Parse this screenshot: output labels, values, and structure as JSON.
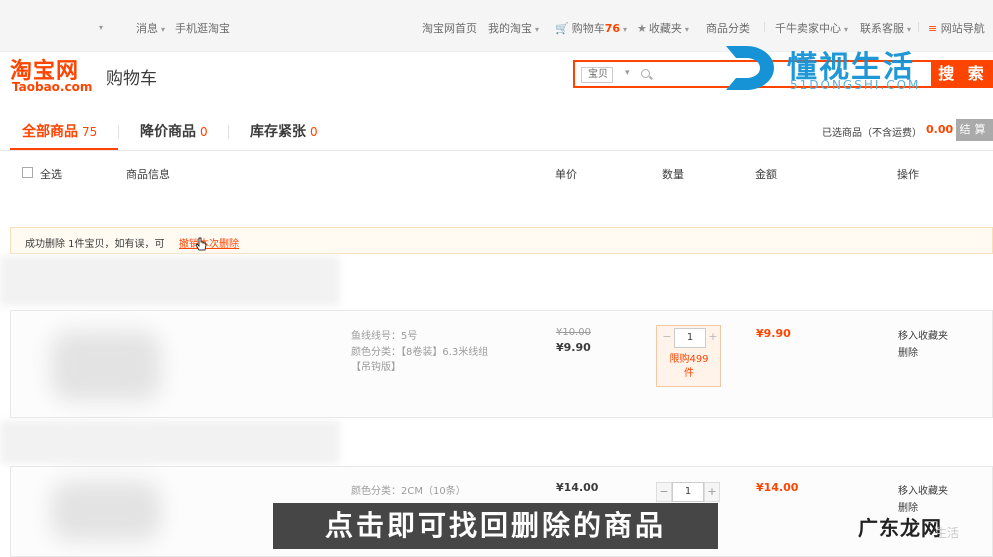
{
  "topbar": {
    "messages": "消息",
    "mobile_taobao": "手机逛淘宝",
    "taobao_home": "淘宝网首页",
    "my_taobao": "我的淘宝",
    "cart_label": "购物车",
    "cart_count": "76",
    "favorites": "收藏夹",
    "categories": "商品分类",
    "seller_center": "千牛卖家中心",
    "customer_service": "联系客服",
    "site_nav": "网站导航"
  },
  "header": {
    "logo_cn": "淘宝网",
    "logo_en": "Taobao.com",
    "title": "购物车",
    "search_scope": "宝贝",
    "search_button": "搜 索"
  },
  "watermark": {
    "title": "懂视生活",
    "subtitle": "51DONGSHI.COM",
    "bottom_brand": "广东龙网",
    "bottom_fade": "生活"
  },
  "tabs": [
    {
      "label": "全部商品",
      "count": "75"
    },
    {
      "label": "降价商品",
      "count": "0"
    },
    {
      "label": "库存紧张",
      "count": "0"
    }
  ],
  "summary": {
    "label": "已选商品（不含运费）",
    "amount": "0.00",
    "settle": "结算"
  },
  "columns": {
    "select_all": "全选",
    "product_info": "商品信息",
    "unit_price": "单价",
    "quantity": "数量",
    "amount": "金额",
    "operation": "操作"
  },
  "notice": {
    "message": "成功删除 1件宝贝，如有误，可",
    "undo_link": "撤销本次删除"
  },
  "items": [
    {
      "attr1": "鱼线线号：5号",
      "attr2": "颜色分类：【8卷装】6.3米线组",
      "attr3": "【吊钩版】",
      "old_price": "¥10.00",
      "price": "¥9.90",
      "quantity": "1",
      "limit": "限购499件",
      "subtotal": "¥9.90",
      "op_fav": "移入收藏夹",
      "op_delete": "删除"
    },
    {
      "attr1": "颜色分类：2CM（10条）",
      "price": "¥14.00",
      "quantity": "1",
      "subtotal": "¥14.00",
      "op_fav": "移入收藏夹",
      "op_delete": "删除"
    }
  ],
  "caption": "点击即可找回删除的商品",
  "colors": {
    "accent": "#ff4400",
    "watermark_blue": "#1593d6"
  }
}
